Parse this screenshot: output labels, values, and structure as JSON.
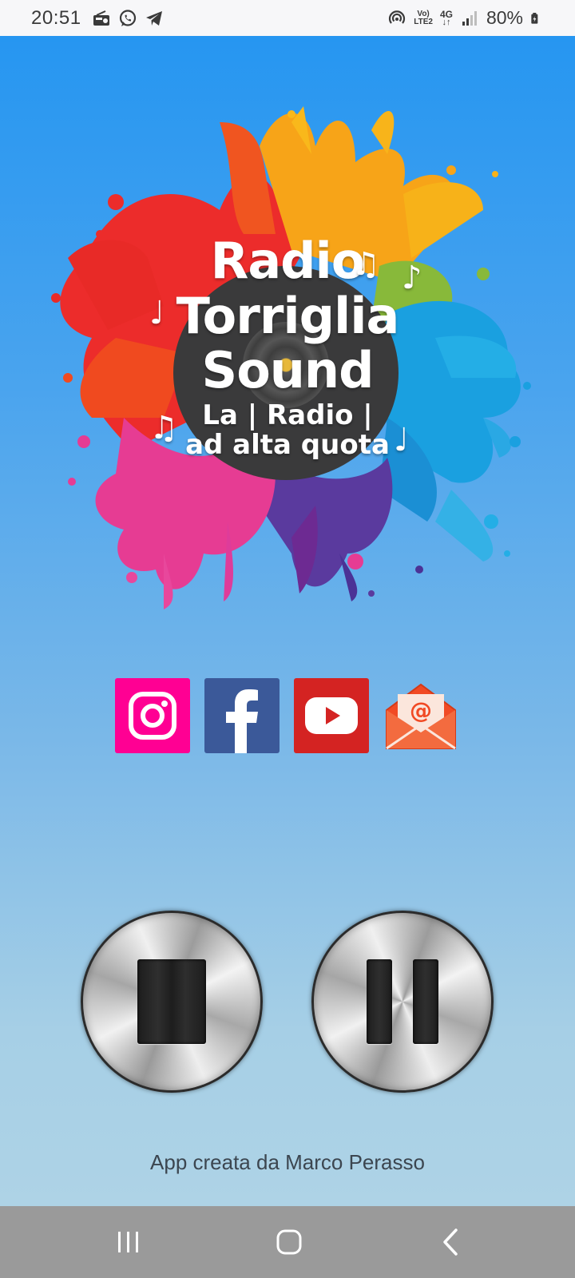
{
  "status_bar": {
    "time": "20:51",
    "icons_left": [
      "radio-icon",
      "whatsapp-icon",
      "telegram-icon"
    ],
    "icons_right": [
      "hotspot-icon",
      "volte-icon",
      "4g-icon",
      "signal-icon",
      "battery-icon"
    ],
    "volte_label_top": "Vo)",
    "volte_label_bottom": "LTE2",
    "network_label": "4G",
    "battery": "80%"
  },
  "logo": {
    "line1": "Radio",
    "line2": "Torriglia",
    "line3": "Sound",
    "line4": "La | Radio |",
    "line5": "ad alta quota",
    "disc_color": "#3a3a3b"
  },
  "social": [
    {
      "name": "instagram-icon",
      "color": "#ff0093"
    },
    {
      "name": "facebook-icon",
      "color": "#3b5999"
    },
    {
      "name": "youtube-icon",
      "color": "#d42322"
    },
    {
      "name": "email-icon",
      "color": "#f14a24"
    }
  ],
  "player": {
    "stop_icon": "stop-icon",
    "pause_icon": "pause-icon"
  },
  "footer": {
    "credit": "App creata da Marco Perasso"
  },
  "nav_bar": {
    "recent": "recent-apps-icon",
    "home": "home-icon",
    "back": "back-icon"
  }
}
